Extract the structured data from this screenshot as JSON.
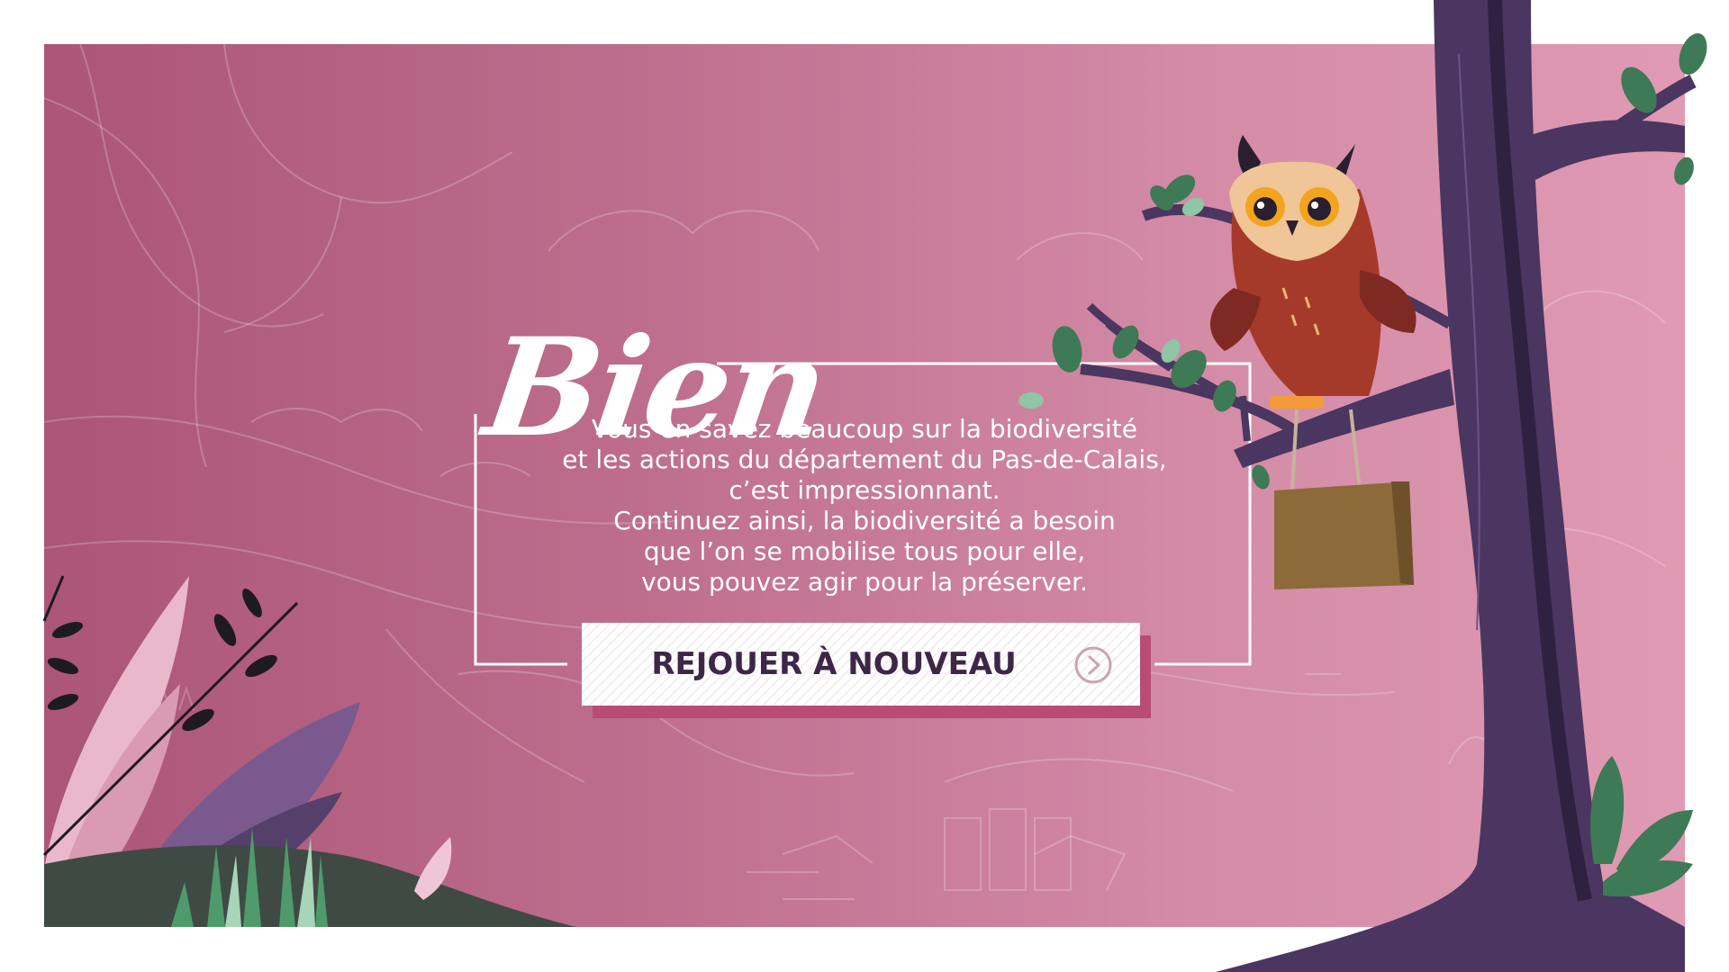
{
  "screen": {
    "title_word": "Bien",
    "message_lines": [
      "Vous en savez beaucoup sur la biodiversité",
      "et les actions du département du Pas-de-Calais,",
      "c’est impressionnant.",
      "Continuez ainsi, la biodiversité a besoin",
      "que l’on se mobilise tous pour elle,",
      "vous pouvez agir pour la préserver."
    ],
    "replay_button": {
      "label": "REJOUER À NOUVEAU",
      "icon": "chevron-right-circle-icon"
    }
  },
  "illustration": {
    "character": "owl-icon",
    "props": [
      "paper-bag-icon",
      "tree-icon",
      "leaf-icon",
      "fern-icon"
    ]
  },
  "colors": {
    "background_left": "#ab5577",
    "background_right": "#e09ab3",
    "button_text": "#3e2746",
    "button_shadow": "#b84c72",
    "tree": "#4a3660",
    "owl_body": "#a63a2a",
    "leaf": "#3e7a55"
  }
}
